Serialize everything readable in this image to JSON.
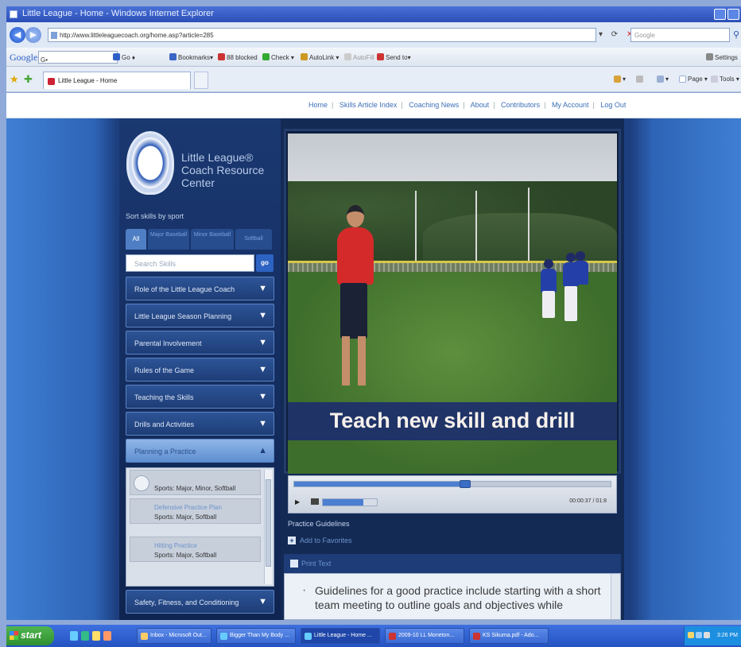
{
  "browser": {
    "title": "Little League - Home - Windows Internet Explorer",
    "url": "http://www.littleleaguecoach.org/home.asp?article=285",
    "search_placeholder": "Google",
    "google_bar": {
      "logo": "Google",
      "input_suffix": "G•",
      "tools": [
        "Go ♦",
        "Bookmarks▾",
        "88 blocked",
        "Check ▾",
        "AutoLink ▾",
        "AutoFill",
        "Send to▾"
      ],
      "settings": "Settings"
    },
    "tab": {
      "label": "Little League - Home"
    },
    "commands": [
      "Page ▾",
      "Tools ▾"
    ]
  },
  "site_nav": {
    "links": [
      "Home",
      "Skills Article Index",
      "Coaching News",
      "About",
      "Contributors",
      "My Account",
      "Log Out"
    ]
  },
  "sidebar": {
    "logo_text": "Little League® Coach Resource Center",
    "sort_label": "Sort skills by sport",
    "sport_tabs": [
      "All",
      "Major Baseball",
      "Minor Baseball",
      "Softball"
    ],
    "search_placeholder": "Search Skills",
    "go_label": "go",
    "menu": [
      {
        "label": "Role of the Little League Coach",
        "arrow": "▼"
      },
      {
        "label": "Little League Season Planning",
        "arrow": "▼"
      },
      {
        "label": "Parental Involvement",
        "arrow": "▼"
      },
      {
        "label": "Rules of the Game",
        "arrow": "▼"
      },
      {
        "label": "Teaching the Skills",
        "arrow": "▼"
      },
      {
        "label": "Drills and Activities",
        "arrow": "▼"
      },
      {
        "label": "Planning a Practice",
        "arrow": "▲"
      },
      {
        "label": "Safety, Fitness, and Conditioning",
        "arrow": "▼"
      }
    ],
    "sub_items": [
      {
        "title": "",
        "sports": "Sports: Major, Minor, Softball"
      },
      {
        "title": "Defensive Practice Plan",
        "sports": "Sports: Major, Softball"
      },
      {
        "title": "Hitting Practice",
        "sports": "Sports: Major, Softball"
      }
    ]
  },
  "video": {
    "caption": "Teach new skill and drill",
    "progress": 0.54,
    "volume": 0.75,
    "time": "00:00:37 / 01:8",
    "play_icon": "▶"
  },
  "below_video": {
    "section_label": "Practice Guidelines",
    "add_favorites": "Add to Favorites",
    "print_text": "Print Text",
    "guideline_text": "Guidelines for a good practice include starting with a short team meeting to outline goals and objectives while"
  },
  "taskbar": {
    "start": "start",
    "tasks": [
      "Inbox - Microsoft Out...",
      "Bigger Than My Body ...",
      "Little League - Home ...",
      "2009-10 LL Moneton...",
      "KS Sikuma.pdf - Ado..."
    ],
    "clock": "3:26 PM"
  },
  "colors": {
    "page_blue": "#1d3f7f",
    "menu_blue": "#2d5497",
    "accent": "#4c7fd1",
    "coach_shirt": "#d42a2a"
  }
}
